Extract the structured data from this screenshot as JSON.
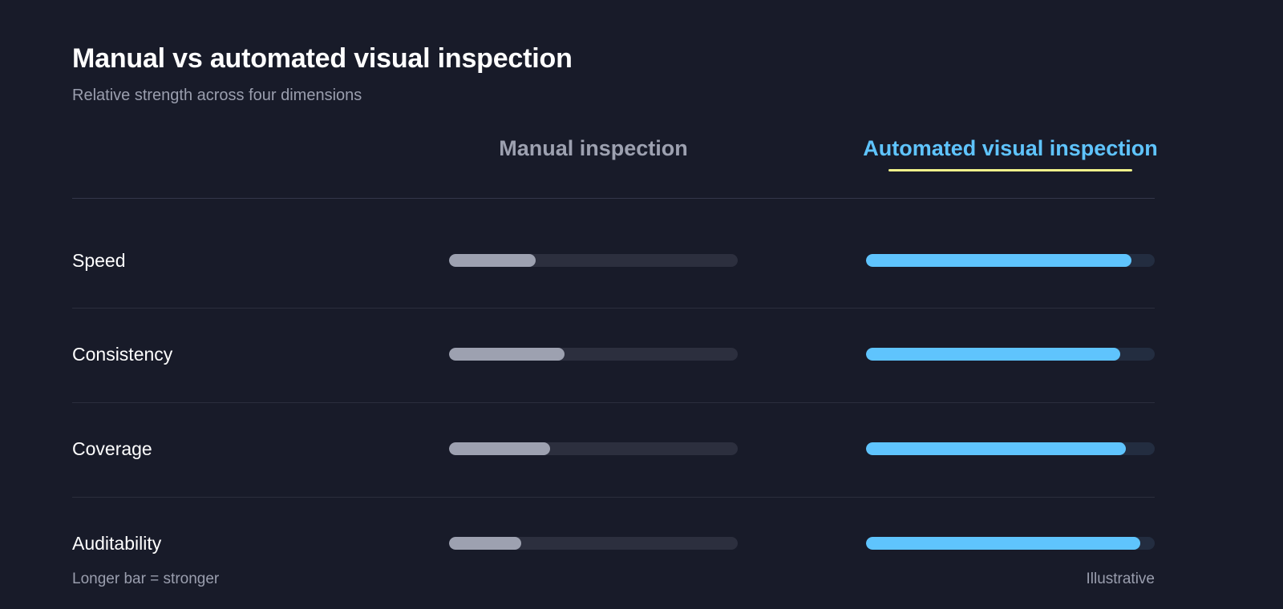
{
  "title": "Manual vs automated visual inspection",
  "subtitle": "Relative strength across four dimensions",
  "footnote_left": "Longer bar = stronger",
  "footnote_right": "Illustrative",
  "colors": {
    "background": "#181b29",
    "manual_fill": "#9da1b0",
    "manual_track": "#2c2f3e",
    "auto_fill": "#5fc4fd",
    "auto_track": "#232d40",
    "manual_header": "#9da1b0",
    "auto_header": "#5fc4fd",
    "accent_underline": "#f0f28a"
  },
  "chart_data": {
    "type": "bar",
    "orientation": "horizontal",
    "title": "Manual vs automated visual inspection",
    "subtitle": "Relative strength across four dimensions",
    "categories": [
      "Speed",
      "Consistency",
      "Coverage",
      "Auditability"
    ],
    "series": [
      {
        "name": "Manual inspection",
        "values": [
          0.3,
          0.4,
          0.35,
          0.25
        ]
      },
      {
        "name": "Automated visual inspection",
        "values": [
          0.92,
          0.88,
          0.9,
          0.95
        ]
      }
    ],
    "xlim": [
      0,
      1
    ],
    "grid": false,
    "legend": "top"
  }
}
